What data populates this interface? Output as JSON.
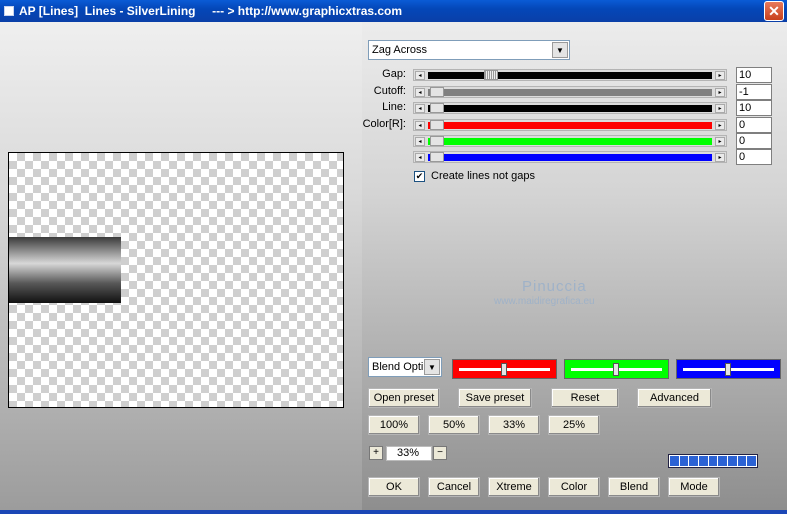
{
  "window": {
    "title": "AP [Lines]  Lines - SilverLining     --- > http://www.graphicxtras.com",
    "close_glyph": "✕"
  },
  "pattern_select": {
    "value": "Zag Across",
    "arrow": "▼"
  },
  "sliders": [
    {
      "label": "Gap:",
      "value": "10",
      "fill": "#000000"
    },
    {
      "label": "Cutoff:",
      "value": "-1",
      "fill": "#808080"
    },
    {
      "label": "Line:",
      "value": "10",
      "fill": "#000000"
    },
    {
      "label": "Color[R]:",
      "value": "0",
      "fill": "#ff0000"
    },
    {
      "label": "",
      "value": "0",
      "fill": "#00ff00"
    },
    {
      "label": "",
      "value": "0",
      "fill": "#0000ff"
    }
  ],
  "arrows": {
    "left": "◂",
    "right": "▸"
  },
  "checkbox": {
    "label": "Create lines not gaps",
    "mark": "✔",
    "checked": true
  },
  "watermark": {
    "line1": "Pinuccia",
    "line2": "www.maidiregrafica.eu"
  },
  "blend_select": {
    "value": "Blend Opti",
    "arrow": "▼"
  },
  "color_boxes": [
    {
      "color": "#ff0000",
      "level": 0.48
    },
    {
      "color": "#00ff00",
      "level": 0.48
    },
    {
      "color": "#0000ff",
      "level": 0.48
    }
  ],
  "buttons_row1": [
    "Open preset",
    "Save preset",
    "Reset",
    "Advanced"
  ],
  "zoom_buttons": [
    "100%",
    "50%",
    "33%",
    "25%"
  ],
  "zoom": {
    "plus": "+",
    "value": "33%",
    "minus": "−"
  },
  "buttons_bottom": [
    "OK",
    "Cancel",
    "Xtreme",
    "Color",
    "Blend",
    "Mode"
  ],
  "progress_segments": 9
}
